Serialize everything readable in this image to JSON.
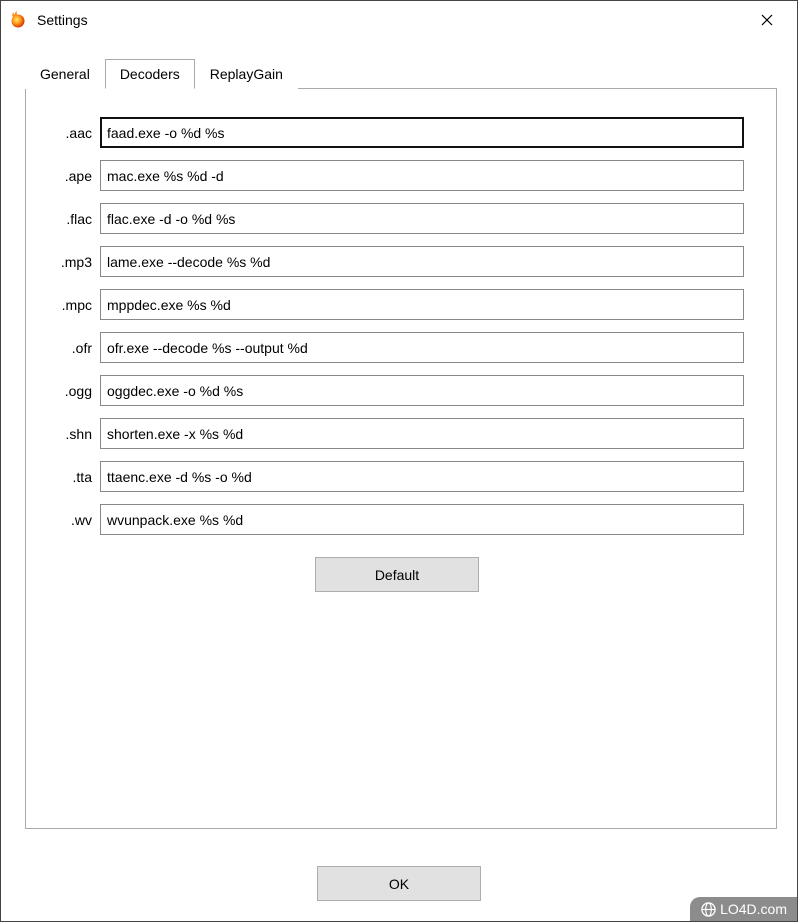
{
  "window": {
    "title": "Settings"
  },
  "tabs": {
    "general": "General",
    "decoders": "Decoders",
    "replaygain": "ReplayGain",
    "active": "decoders"
  },
  "decoders": [
    {
      "ext": ".aac",
      "cmd": "faad.exe -o %d %s"
    },
    {
      "ext": ".ape",
      "cmd": "mac.exe %s %d -d"
    },
    {
      "ext": ".flac",
      "cmd": "flac.exe -d -o %d %s"
    },
    {
      "ext": ".mp3",
      "cmd": "lame.exe --decode %s %d"
    },
    {
      "ext": ".mpc",
      "cmd": "mppdec.exe %s %d"
    },
    {
      "ext": ".ofr",
      "cmd": "ofr.exe --decode %s --output %d"
    },
    {
      "ext": ".ogg",
      "cmd": "oggdec.exe -o %d %s"
    },
    {
      "ext": ".shn",
      "cmd": "shorten.exe -x %s %d"
    },
    {
      "ext": ".tta",
      "cmd": "ttaenc.exe -d %s -o %d"
    },
    {
      "ext": ".wv",
      "cmd": "wvunpack.exe %s %d"
    }
  ],
  "buttons": {
    "default": "Default",
    "ok": "OK"
  },
  "watermark": "LO4D.com"
}
